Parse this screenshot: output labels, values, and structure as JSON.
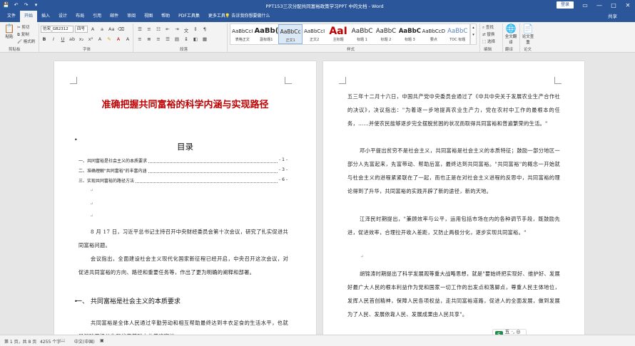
{
  "window": {
    "title": "PPT153三次分配共同富裕政策学习PPT 中的文档 - Word",
    "login_label": "登录",
    "controls": {
      "restore": "▭",
      "minimize": "—",
      "maximize": "□",
      "close": "✕"
    }
  },
  "quick_access": {
    "save": "💾",
    "undo": "↶",
    "redo": "↷",
    "customize": "▾"
  },
  "ribbon_tabs": [
    {
      "label": "文件"
    },
    {
      "label": "开始"
    },
    {
      "label": "插入"
    },
    {
      "label": "设计"
    },
    {
      "label": "布局"
    },
    {
      "label": "引用"
    },
    {
      "label": "邮件"
    },
    {
      "label": "审阅"
    },
    {
      "label": "视图"
    },
    {
      "label": "帮助"
    },
    {
      "label": "PDF工具集"
    },
    {
      "label": "更多工具"
    }
  ],
  "tell_me": "💡 告诉我你想要做什么",
  "share": "共享",
  "ribbon": {
    "paste": "粘贴",
    "cut": "剪切",
    "copy": "复制",
    "format_painter": "格式刷",
    "font_name": "仿宋_GB2312",
    "font_size": "四号",
    "clipboard_label": "剪贴板",
    "font_label": "字体",
    "paragraph_label": "段落",
    "styles_label": "样式",
    "find": "查找",
    "replace": "替换",
    "select": "选择",
    "editing_label": "编辑",
    "fulltext_translate": "全文翻译",
    "paper_check": "论文查重",
    "translate_label": "翻译",
    "paper_label": "论文",
    "styles": [
      {
        "sample": "AaBbCcI",
        "name": "表格正文"
      },
      {
        "sample": "AaBb(",
        "name": "副标题1"
      },
      {
        "sample": "AaBbCc",
        "name": "正文1"
      },
      {
        "sample": "AaBbCcI",
        "name": "正文2"
      },
      {
        "sample": "AaI",
        "name": "主标题"
      },
      {
        "sample": "AaBbC",
        "name": "标题 1"
      },
      {
        "sample": "AaBbC",
        "name": "标题 2"
      },
      {
        "sample": "AaBbC",
        "name": "标题 3"
      },
      {
        "sample": "AaBbCcD",
        "name": "要点"
      },
      {
        "sample": "AaBbC",
        "name": "TOC 标题"
      }
    ]
  },
  "page1": {
    "title": "准确把握共同富裕的科学内涵与实现路径",
    "toc_title": "目录",
    "toc": [
      {
        "label": "一、共同富裕是社会主义的本质要求",
        "page": "- 1 -"
      },
      {
        "label": "二、准确理解\"共同富裕\"的丰富内涵",
        "page": "- 3 -"
      },
      {
        "label": "三、实现共同富裕的路径方法",
        "page": "- 6 -"
      }
    ],
    "para1": "8 月 17 日，习近平总书记主持召开中央财经委员会第十次会议，研究了扎实促进共同富裕问题。",
    "para2": "会议指出，全面建设社会主义现代化国家新征程已经开启，中央召开这次会议，对促进共同富裕的方向、路径和重要任务等，作出了更为明确的阐释和部署。",
    "heading1": "一、  共同富裕是社会主义的本质要求",
    "para3": "共同富裕是全体人民通过辛勤劳动和相互帮助最终达到丰衣足食的生活水平，也就是消除两极分化和贫穷基础上的普遍富裕。"
  },
  "page2": {
    "para1": "五三年十二月十六日，中国共产党中央委员会通过了《中共中央关于发展农业生产合作社的决议》，决议指出：\"为着逐一步地提高农业生产力，党在农村中工作的最根本的任务，……并使农民能够逐步完全摆脱贫困的状况而取得共同富裕和普遍繁荣的生活。\"",
    "para2": "邓小平提出贫穷不是社会主义，共同富裕是社会主义的本质特征；鼓励一部分地区一部分人先富起来，先富带动、帮助后富，最终达到共同富裕。\"共同富裕\"的概念一开始就与社会主义的进程紧紧联在了一起，而也正是在对社会主义进程的反思中，共同富裕的理论得到了升华，共同富裕的实践开辟了新的途径，新的天地。",
    "para3": "江泽民时期提出，\"兼顾效率与公平，运用包括市场在内的各种调节手段，既鼓励先进，促进效率，合理拉开收入差距，又防止两极分化，逐步实现共同富裕。\"",
    "para4": "胡锦涛时期提出了科学发展观等重大战略思想，就是\"要始终把实现好、维护好、发展好最广大人民的根本利益作为党和国家一切工作的出发点和落脚点，尊重人民主体地位，发挥人民首创精神，保障人民各项权益，走共同富裕道路，促进人的全面发展，做到发展为了人民、发展依靠人民、发展成果由人民共享\"。"
  },
  "statusbar": {
    "page": "第 1 页，共 8 页",
    "words": "4255 个字",
    "lang": "中文(中国)"
  },
  "wps_widget": {
    "icon": "S",
    "text": "五 ·, ◎ ▦"
  }
}
